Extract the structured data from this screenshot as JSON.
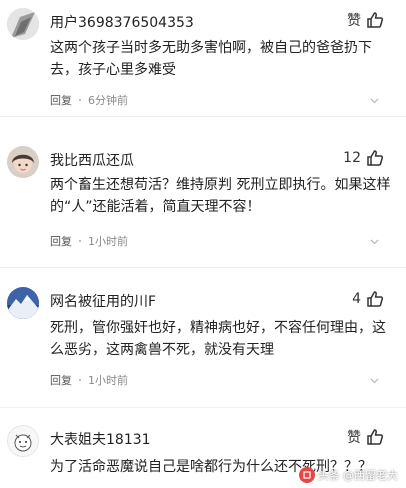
{
  "comments": [
    {
      "username": "用户3698376504353",
      "likes": "赞",
      "text": "这两个孩子当时多无助多害怕啊，被自己的爸爸扔下去，孩子心里多难受",
      "reply_label": "回复",
      "time": "6分钟前",
      "avatar_icon": "default-user-avatar"
    },
    {
      "username": "我比西瓜还瓜",
      "likes": "12",
      "text": "两个畜生还想苟活？维持原判 死刑立即执行。如果这样的“人”还能活着，简直天理不容！",
      "reply_label": "回复",
      "time": "1小时前",
      "avatar_icon": "girl-avatar"
    },
    {
      "username": "网名被征用的川F",
      "likes": "4",
      "text": "死刑，管你强奸也好，精神病也好，不容任何理由，这么恶劣，这两禽兽不死，就没有天理",
      "reply_label": "回复",
      "time": "1小时前",
      "avatar_icon": "mountain-avatar"
    },
    {
      "username": "大表姐夫18131",
      "likes": "赞",
      "text": "为了活命恶魔说自己是啥都行为什么还不死刑？？？",
      "reply_label": "",
      "time": "",
      "avatar_icon": "cartoon-avatar"
    }
  ],
  "watermark": {
    "text": "头条 @西留老大"
  },
  "colors": {
    "text_primary": "#222222",
    "text_meta": "#888888",
    "divider": "#f1f1f1"
  }
}
